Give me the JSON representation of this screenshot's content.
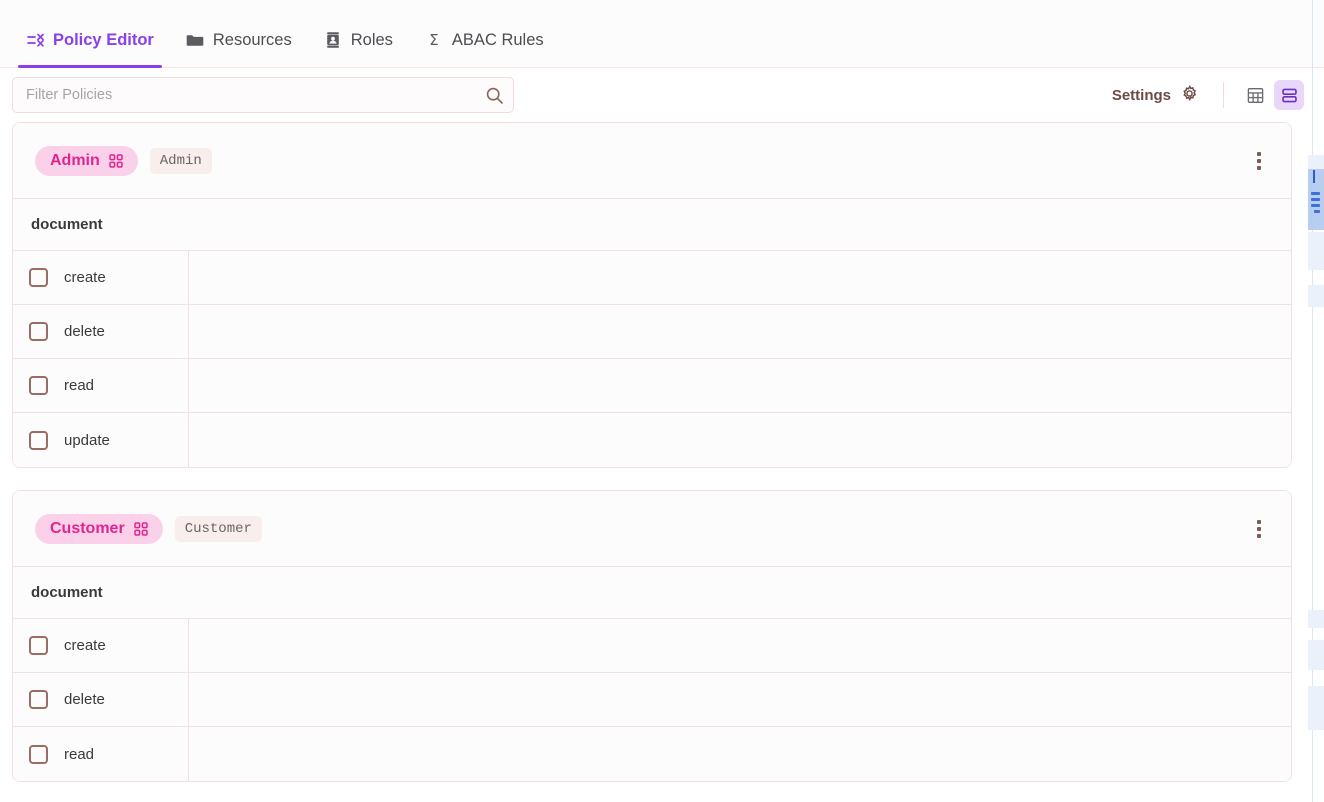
{
  "tabs": [
    {
      "id": "policy-editor",
      "label": "Policy Editor",
      "icon": "filter-x-icon",
      "active": true
    },
    {
      "id": "resources",
      "label": "Resources",
      "icon": "folder-icon",
      "active": false
    },
    {
      "id": "roles",
      "label": "Roles",
      "icon": "badge-icon",
      "active": false
    },
    {
      "id": "abac-rules",
      "label": "ABAC Rules",
      "icon": "sigma-icon",
      "active": false
    }
  ],
  "toolbar": {
    "search_placeholder": "Filter Policies",
    "search_value": "",
    "search_icon": "search-icon",
    "settings_label": "Settings",
    "settings_icon": "gear-icon",
    "view_table_icon": "table-view-icon",
    "view_rows_icon": "rows-view-icon",
    "active_view": "rows"
  },
  "colors": {
    "accent": "#8b3fe8",
    "pill_bg": "#fbd1ea",
    "pill_text": "#e0258f",
    "chip_bg": "#f8efec",
    "border": "#f2e2df",
    "checkbox_border": "#9a6c64",
    "active_view_bg": "#e9d7fb"
  },
  "policies": [
    {
      "id": "admin",
      "pill_label": "Admin",
      "pill_icon": "grid-2x2-icon",
      "chip_label": "Admin",
      "menu_icon": "kebab-menu-icon",
      "resources": [
        {
          "name": "document",
          "actions": [
            {
              "name": "create",
              "checked": false,
              "value": ""
            },
            {
              "name": "delete",
              "checked": false,
              "value": ""
            },
            {
              "name": "read",
              "checked": false,
              "value": ""
            },
            {
              "name": "update",
              "checked": false,
              "value": ""
            }
          ]
        }
      ]
    },
    {
      "id": "customer",
      "pill_label": "Customer",
      "pill_icon": "grid-2x2-icon",
      "chip_label": "Customer",
      "menu_icon": "kebab-menu-icon",
      "resources": [
        {
          "name": "document",
          "actions": [
            {
              "name": "create",
              "checked": false,
              "value": ""
            },
            {
              "name": "delete",
              "checked": false,
              "value": ""
            },
            {
              "name": "read",
              "checked": false,
              "value": ""
            }
          ]
        }
      ]
    }
  ]
}
